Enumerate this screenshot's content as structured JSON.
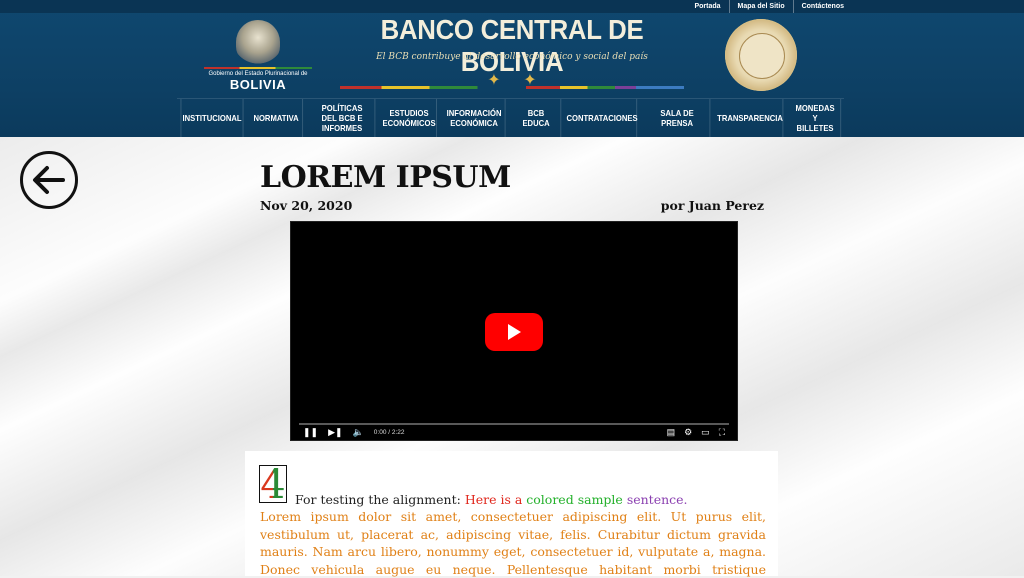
{
  "top_links": [
    "Portada",
    "Mapa del Sitio",
    "Contáctenos"
  ],
  "gov": {
    "line1": "Gobierno del Estado Plurinacional de",
    "line2": "BOLIVIA"
  },
  "site": {
    "title": "BANCO CENTRAL DE BOLIVIA",
    "tagline": "El BCB contribuye al desarrollo económico y social del país"
  },
  "nav": [
    "INSTITUCIONAL",
    "NORMATIVA",
    "POLÍTICAS DEL BCB E INFORMES",
    "ESTUDIOS ECONÓMICOS",
    "INFORMACIÓN ECONÓMICA",
    "BCB EDUCA",
    "CONTRATACIONES",
    "SALA DE PRENSA",
    "TRANSPARENCIA",
    "MONEDAS Y BILLETES"
  ],
  "post": {
    "title": "LOREM IPSUM",
    "date": "Nov 20, 2020",
    "author": "por Juan Perez"
  },
  "video": {
    "time": "0:00 / 2:22"
  },
  "doc": {
    "dropcap": "4",
    "align_prefix": "For testing the alignment:",
    "here": "Here is a",
    "colored": "colored",
    "sample": "sample",
    "sentence": "sentence.",
    "lorem": "Lorem ipsum dolor sit amet, consectetuer adipiscing elit. Ut purus elit, vestibulum ut, placerat ac, adipiscing vitae, felis. Curabitur dictum gravida mauris. Nam arcu libero, nonummy eget, consectetuer id, vulputate a, magna. Donec vehicula augue eu neque. Pellentesque habitant morbi tristique senectus et ne-"
  },
  "colors": {
    "header": "#0d3f63",
    "accent_red": "#ff0000",
    "doc_orange": "#e08016"
  }
}
